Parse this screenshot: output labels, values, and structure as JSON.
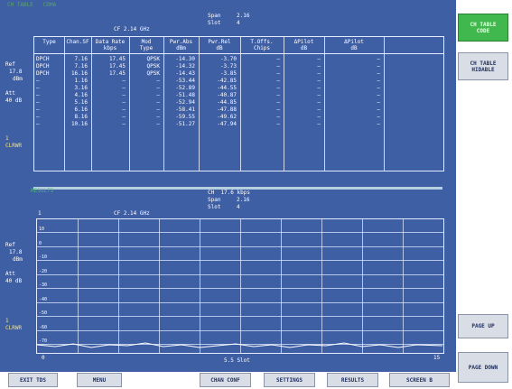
{
  "header": {
    "top_left": "CH TABLE   CDMA",
    "span_label": "Span",
    "span_value": "2.16",
    "slot_label": "Slot",
    "slot_value": "4",
    "cf": "CF 2.14 GHz"
  },
  "left_labels": {
    "ref": "Ref",
    "ref_value": "17.8",
    "ref_unit": "dBm",
    "att": "Att",
    "att_value": "40 dB",
    "marker": "1",
    "marker_value": "CLRWR"
  },
  "table": {
    "columns": [
      "Type",
      "Chan.SF",
      "Data Rate\nkbps",
      "Mod\nType",
      "Pwr.Abs\ndBm",
      "Pwr.Rel\ndB",
      "T.Offs.\nChips",
      "ΔPilot\ndB",
      "ΔPilot\ndB"
    ],
    "rows": [
      [
        "DPCH",
        "7.16",
        "17.45",
        "QPSK",
        "-14.30",
        "-3.70",
        "—",
        "—",
        "—"
      ],
      [
        "DPCH",
        "7.16",
        "17.45",
        "QPSK",
        "-14.32",
        "-3.73",
        "—",
        "—",
        "—"
      ],
      [
        "DPCH",
        "16.16",
        "17.45",
        "QPSK",
        "-14.43",
        "-3.85",
        "—",
        "—",
        "—"
      ],
      [
        "—",
        "1.16",
        "—",
        "—",
        "-53.44",
        "-42.85",
        "—",
        "—",
        "—"
      ],
      [
        "—",
        "3.16",
        "—",
        "—",
        "-52.89",
        "-44.55",
        "—",
        "—",
        "—"
      ],
      [
        "—",
        "4.16",
        "—",
        "—",
        "-51.48",
        "-40.87",
        "—",
        "—",
        "—"
      ],
      [
        "—",
        "5.16",
        "—",
        "—",
        "-52.94",
        "-44.85",
        "—",
        "—",
        "—"
      ],
      [
        "—",
        "6.16",
        "—",
        "—",
        "-58.41",
        "-47.88",
        "—",
        "—",
        "—"
      ],
      [
        "—",
        "8.16",
        "—",
        "—",
        "-59.55",
        "-49.62",
        "—",
        "—",
        "—"
      ],
      [
        "—",
        "10.16",
        "—",
        "—",
        "-51.27",
        "-47.94",
        "—",
        "—",
        "—"
      ]
    ]
  },
  "lower": {
    "green_label": "RESULTS",
    "title_line1": "CH  17.6 kbps",
    "span_label": "Span",
    "span_value": "2.16",
    "slot_label": "Slot",
    "slot_value": "4",
    "cf": "CF 2.14 GHz",
    "marker_tag": "1",
    "ref": "Ref",
    "ref_value": "17.8",
    "ref_unit": "dBm",
    "att": "Att",
    "att_value": "40 dB",
    "marker": "1",
    "marker_value": "CLRWR",
    "x_start": "0",
    "x_center": "5.5 Slot",
    "x_end": "15",
    "y_ticks": [
      "10",
      "0",
      "-10",
      "-20",
      "-30",
      "-40",
      "-50",
      "-60",
      "-70"
    ]
  },
  "right_buttons": [
    {
      "label": "CH TABLE\nCODE",
      "active": true
    },
    {
      "label": "CH TABLE\nHIDABLE",
      "active": false
    },
    {
      "label": "PAGE UP",
      "active": false
    },
    {
      "label": "PAGE DOWN",
      "active": false
    }
  ],
  "bottom_buttons": [
    "EXIT TDS",
    "MENU",
    "CHAN CONF",
    "SETTINGS",
    "RESULTS",
    "SCREEN B"
  ],
  "colors": {
    "screen": "#3f5fa5",
    "accent_green": "#40b84e"
  }
}
